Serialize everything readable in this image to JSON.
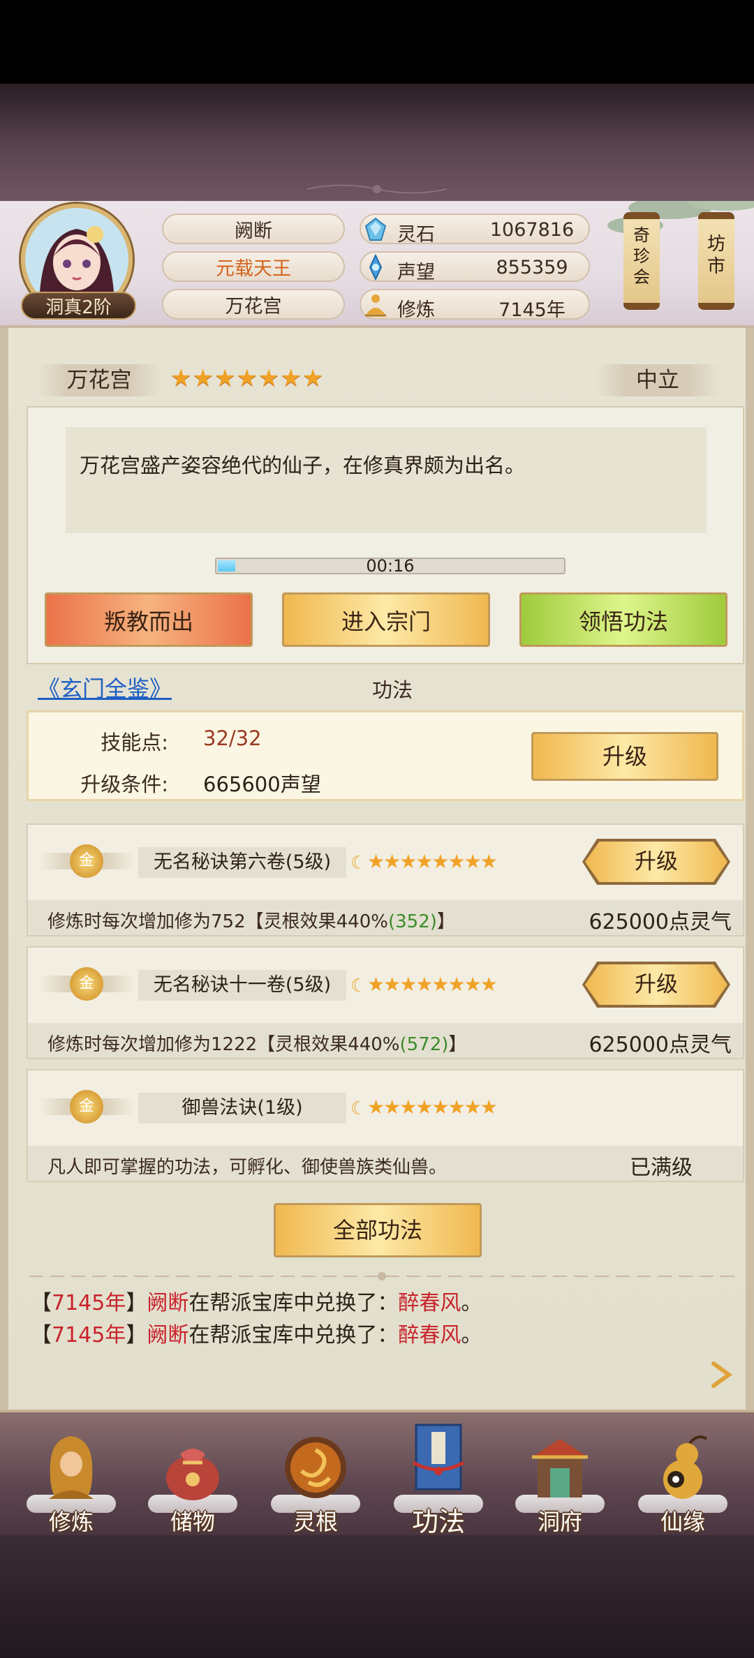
{
  "player": {
    "name": "阙断",
    "title": "元载天王",
    "sect": "万花宫",
    "realm": "洞真2阶"
  },
  "resources": [
    {
      "icon": "spirit-stone-icon",
      "label": "灵石",
      "value": "1067816"
    },
    {
      "icon": "prestige-icon",
      "label": "声望",
      "value": "855359"
    },
    {
      "icon": "cultivation-icon",
      "label": "修炼",
      "value": "7145年"
    }
  ],
  "side_buttons": {
    "treasure": "奇\n珍\n会",
    "market": "坊\n市"
  },
  "sect_panel": {
    "name": "万花宫",
    "stars": "★★★★★★★",
    "stance": "中立",
    "description": "万花宫盛产姿容绝代的仙子，在修真界颇为出名。",
    "progress_time": "00:16",
    "progress": 0.05,
    "buttons": {
      "betray": "叛教而出",
      "enter": "进入宗门",
      "comprehend": "领悟功法"
    }
  },
  "skills_section": {
    "link": "《玄门全鉴》",
    "title": "功法"
  },
  "skill_points": {
    "points_label": "技能点:",
    "points_value": "32/32",
    "condition_label": "升级条件:",
    "condition_value": "665600声望",
    "upgrade": "升级"
  },
  "skills": [
    {
      "badge": "金",
      "name": "无名秘诀第六卷(5级)",
      "stars": "★★★★★★★★",
      "desc_main": "修炼时每次增加修为752【灵根效果440%",
      "desc_green": "(352)",
      "desc_end": "】",
      "cost": "625000点灵气",
      "button": "升级"
    },
    {
      "badge": "金",
      "name": "无名秘诀十一卷(5级)",
      "stars": "★★★★★★★★",
      "desc_main": "修炼时每次增加修为1222【灵根效果440%",
      "desc_green": "(572)",
      "desc_end": "】",
      "cost": "625000点灵气",
      "button": "升级"
    },
    {
      "badge": "金",
      "name": "御兽法诀(1级)",
      "stars": "★★★★★★★★",
      "desc_main": "凡人即可掌握的功法，可孵化、御使兽族类仙兽。",
      "desc_green": "",
      "desc_end": "",
      "cost": "已满级",
      "button": ""
    }
  ],
  "all_skills_button": "全部功法",
  "logs": [
    {
      "open": "【",
      "year": "7145年",
      "close": "】",
      "name": "阙断",
      "action": "在帮派宝库中兑换了：",
      "item": "醉春风",
      "end": "。"
    },
    {
      "open": "【",
      "year": "7145年",
      "close": "】",
      "name": "阙断",
      "action": "在帮派宝库中兑换了：",
      "item": "醉春风",
      "end": "。"
    }
  ],
  "bottom_nav": [
    {
      "label": "修炼",
      "icon": "meditating-monk-icon"
    },
    {
      "label": "储物",
      "icon": "treasure-bag-icon"
    },
    {
      "label": "灵根",
      "icon": "spirit-root-icon"
    },
    {
      "label": "功法",
      "icon": "scripture-book-icon",
      "active": true
    },
    {
      "label": "洞府",
      "icon": "cave-dwelling-icon"
    },
    {
      "label": "仙缘",
      "icon": "gourd-icon"
    }
  ],
  "colors": {
    "accent_gold": "#f0b84f",
    "star": "#f0a226",
    "log_red": "#c8232a",
    "link_blue": "#1e5fc4",
    "green_value": "#3a8c2a"
  }
}
